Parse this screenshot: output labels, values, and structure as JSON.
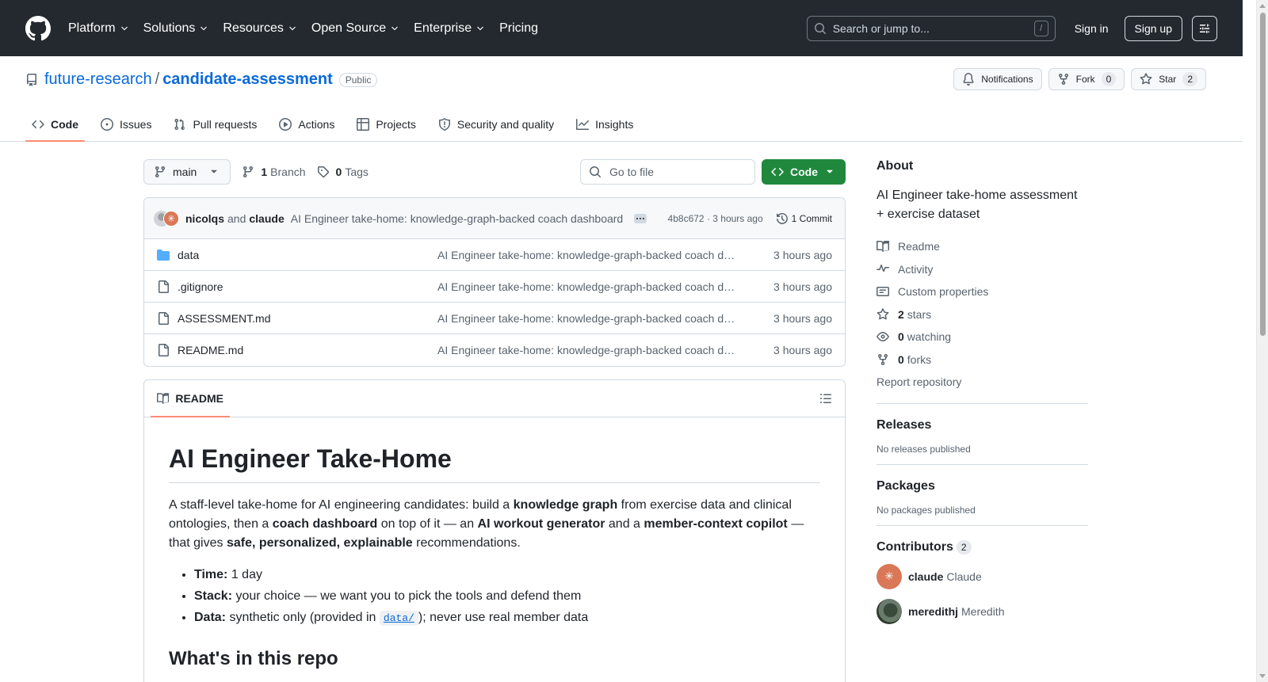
{
  "header": {
    "nav": [
      {
        "label": "Platform",
        "dropdown": true
      },
      {
        "label": "Solutions",
        "dropdown": true
      },
      {
        "label": "Resources",
        "dropdown": true
      },
      {
        "label": "Open Source",
        "dropdown": true
      },
      {
        "label": "Enterprise",
        "dropdown": true
      },
      {
        "label": "Pricing",
        "dropdown": false
      }
    ],
    "search_placeholder": "Search or jump to...",
    "search_shortcut": "/",
    "sign_in": "Sign in",
    "sign_up": "Sign up"
  },
  "repo": {
    "owner": "future-research",
    "separator": "/",
    "name": "candidate-assessment",
    "visibility": "Public",
    "notifications_label": "Notifications",
    "fork_label": "Fork",
    "fork_count": "0",
    "star_label": "Star",
    "star_count": "2"
  },
  "tabs": [
    {
      "label": "Code",
      "icon": "code-icon",
      "active": true
    },
    {
      "label": "Issues",
      "icon": "issue-icon",
      "active": false
    },
    {
      "label": "Pull requests",
      "icon": "pull-request-icon",
      "active": false
    },
    {
      "label": "Actions",
      "icon": "play-icon",
      "active": false
    },
    {
      "label": "Projects",
      "icon": "table-icon",
      "active": false
    },
    {
      "label": "Security and quality",
      "icon": "shield-icon",
      "active": false
    },
    {
      "label": "Insights",
      "icon": "graph-icon",
      "active": false
    }
  ],
  "toolbar": {
    "branch": "main",
    "branch_count": "1",
    "branch_label": "Branch",
    "tag_count": "0",
    "tag_label": "Tags",
    "goto_placeholder": "Go to file",
    "code_label": "Code"
  },
  "commit": {
    "author1": "nicolqs",
    "and": "and",
    "author2": "claude",
    "message": "AI Engineer take-home: knowledge-graph-backed coach dashboard",
    "sha": "4b8c672",
    "time": "· 3 hours ago",
    "commits_label": "1 Commit"
  },
  "files": [
    {
      "name": "data",
      "type": "folder",
      "message": "AI Engineer take-home: knowledge-graph-backed coach dashboard",
      "date": "3 hours ago"
    },
    {
      "name": ".gitignore",
      "type": "file",
      "message": "AI Engineer take-home: knowledge-graph-backed coach dashboard",
      "date": "3 hours ago"
    },
    {
      "name": "ASSESSMENT.md",
      "type": "file",
      "message": "AI Engineer take-home: knowledge-graph-backed coach dashboard",
      "date": "3 hours ago"
    },
    {
      "name": "README.md",
      "type": "file",
      "message": "AI Engineer take-home: knowledge-graph-backed coach dashboard",
      "date": "3 hours ago"
    }
  ],
  "readme": {
    "tab_label": "README",
    "title": "AI Engineer Take-Home",
    "intro": [
      {
        "t": "A staff-level take-home for AI engineering candidates: build a ",
        "b": false
      },
      {
        "t": "knowledge graph",
        "b": true
      },
      {
        "t": " from exercise data and clinical ontologies, then a ",
        "b": false
      },
      {
        "t": "coach dashboard",
        "b": true
      },
      {
        "t": " on top of it — an ",
        "b": false
      },
      {
        "t": "AI workout generator",
        "b": true
      },
      {
        "t": " and a ",
        "b": false
      },
      {
        "t": "member-context copilot",
        "b": true
      },
      {
        "t": " — that gives ",
        "b": false
      },
      {
        "t": "safe, personalized, explainable",
        "b": true
      },
      {
        "t": " recommendations.",
        "b": false
      }
    ],
    "bullets": [
      {
        "label": "Time:",
        "text": " 1 day"
      },
      {
        "label": "Stack:",
        "text": " your choice — we want you to pick the tools and defend them"
      },
      {
        "label": "Data:",
        "text": " synthetic only (provided in ",
        "code": "data/",
        "after": "); never use real member data"
      }
    ],
    "section2": "What's in this repo"
  },
  "about": {
    "heading": "About",
    "description": "AI Engineer take-home assessment + exercise dataset",
    "links": [
      {
        "icon": "book-icon",
        "label": "Readme"
      },
      {
        "icon": "pulse-icon",
        "label": "Activity"
      },
      {
        "icon": "note-icon",
        "label": "Custom properties"
      },
      {
        "icon": "star-icon",
        "count": "2",
        "label": "stars"
      },
      {
        "icon": "eye-icon",
        "count": "0",
        "label": "watching"
      },
      {
        "icon": "fork-icon",
        "count": "0",
        "label": "forks"
      }
    ],
    "report": "Report repository"
  },
  "releases": {
    "heading": "Releases",
    "none": "No releases published"
  },
  "packages": {
    "heading": "Packages",
    "none": "No packages published"
  },
  "contributors": {
    "heading": "Contributors",
    "count": "2",
    "list": [
      {
        "login": "claude",
        "name": "Claude"
      },
      {
        "login": "meredithj",
        "name": "Meredith"
      }
    ]
  }
}
